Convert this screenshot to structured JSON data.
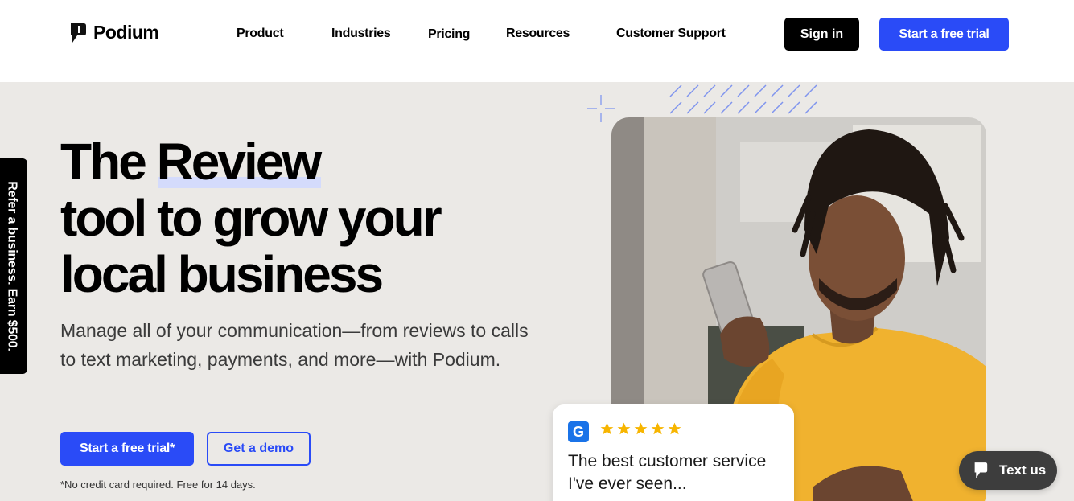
{
  "header": {
    "logo_text": "Podium",
    "nav": [
      "Product",
      "Industries",
      "Pricing",
      "Resources",
      "Customer Support"
    ],
    "sign_in_label": "Sign in",
    "trial_label": "Start a free trial"
  },
  "refer_tab": {
    "label": "Refer a business. Earn $500."
  },
  "hero": {
    "title_word1": "The",
    "title_highlight": "Review",
    "title_line2": "tool to grow your",
    "title_line3": "local business",
    "subtitle": "Manage all of your communication—from reviews to calls to text marketing, payments, and more—with Podium.",
    "trial_button": "Start a free trial*",
    "demo_button": "Get a demo",
    "fineprint": "*No credit card required. Free for 14 days."
  },
  "review_card": {
    "source_icon": "G",
    "rating": 5,
    "text": "The best customer service I've ever seen..."
  },
  "chat_widget": {
    "label": "Text us"
  },
  "colors": {
    "brand_blue": "#2a4bf7",
    "star": "#f7b500",
    "hero_bg": "#ebe9e6",
    "sweater": "#f0b22f"
  }
}
